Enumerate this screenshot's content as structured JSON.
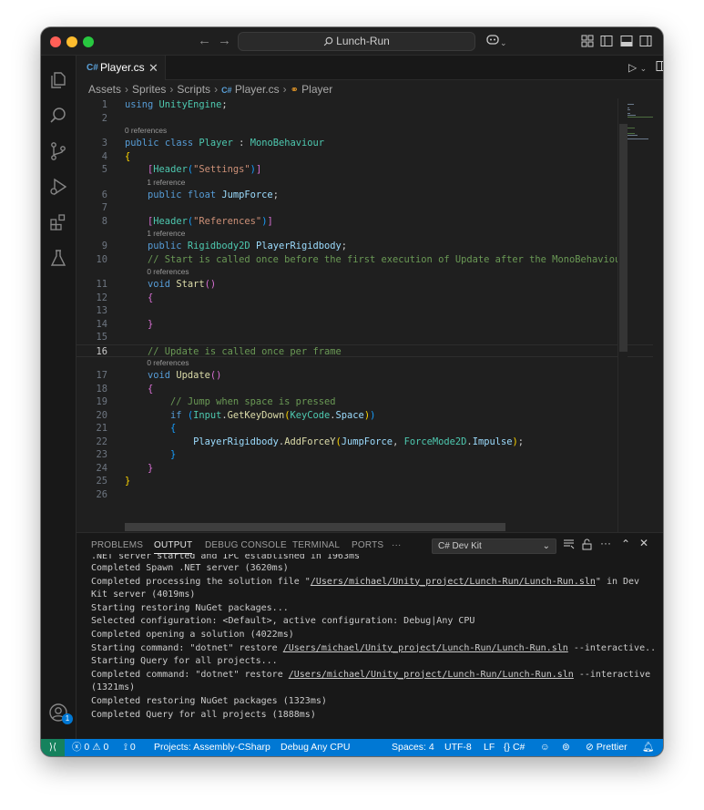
{
  "window": {
    "search_text": "Lunch-Run"
  },
  "tab": {
    "label": "Player.cs",
    "icon": "csharp-file-icon"
  },
  "breadcrumb": {
    "items": [
      "Assets",
      "Sprites",
      "Scripts",
      "Player.cs",
      "Player"
    ]
  },
  "code": {
    "current_line": 16,
    "lines": [
      {
        "n": "1",
        "lens": "",
        "text": "using UnityEngine;"
      },
      {
        "n": "2",
        "lens": "",
        "text": ""
      },
      {
        "n": "3",
        "lens": "0 references",
        "text": "public class Player : MonoBehaviour"
      },
      {
        "n": "4",
        "lens": "",
        "text": "{"
      },
      {
        "n": "5",
        "lens": "",
        "text": "    [Header(\"Settings\")]"
      },
      {
        "n": "6",
        "lens": "1 reference",
        "text": "    public float JumpForce;"
      },
      {
        "n": "7",
        "lens": "",
        "text": ""
      },
      {
        "n": "8",
        "lens": "",
        "text": "    [Header(\"References\")]"
      },
      {
        "n": "9",
        "lens": "1 reference",
        "text": "    public Rigidbody2D PlayerRigidbody;"
      },
      {
        "n": "10",
        "lens": "",
        "text": "    // Start is called once before the first execution of Update after the MonoBehaviou"
      },
      {
        "n": "11",
        "lens": "0 references",
        "text": "    void Start()"
      },
      {
        "n": "12",
        "lens": "",
        "text": "    {"
      },
      {
        "n": "13",
        "lens": "",
        "text": ""
      },
      {
        "n": "14",
        "lens": "",
        "text": "    }"
      },
      {
        "n": "15",
        "lens": "",
        "text": ""
      },
      {
        "n": "16",
        "lens": "",
        "text": "    // Update is called once per frame"
      },
      {
        "n": "17",
        "lens": "0 references",
        "text": "    void Update()"
      },
      {
        "n": "18",
        "lens": "",
        "text": "    {"
      },
      {
        "n": "19",
        "lens": "",
        "text": "        // Jump when space is pressed"
      },
      {
        "n": "20",
        "lens": "",
        "text": "        if (Input.GetKeyDown(KeyCode.Space))"
      },
      {
        "n": "21",
        "lens": "",
        "text": "        {"
      },
      {
        "n": "22",
        "lens": "",
        "text": "            PlayerRigidbody.AddForceY(JumpForce, ForceMode2D.Impulse);"
      },
      {
        "n": "23",
        "lens": "",
        "text": "        }"
      },
      {
        "n": "24",
        "lens": "",
        "text": "    }"
      },
      {
        "n": "25",
        "lens": "",
        "text": "}"
      },
      {
        "n": "26",
        "lens": "",
        "text": ""
      }
    ]
  },
  "panel": {
    "tabs": [
      "PROBLEMS",
      "OUTPUT",
      "DEBUG CONSOLE",
      "TERMINAL",
      "PORTS",
      "···"
    ],
    "active_tab": "OUTPUT",
    "channel": "C# Dev Kit",
    "output_lines": [
      ".NET server started and IPC established in 1963ms",
      "Completed Spawn .NET server (3620ms)",
      "Completed processing the solution file \"/Users/michael/Unity_project/Lunch-Run/Lunch-Run.sln\" in Dev",
      "Kit server (4019ms)",
      "Starting restoring NuGet packages...",
      "Selected configuration: <Default>, active configuration: Debug|Any CPU",
      "Completed opening a solution (4022ms)",
      "Starting command: \"dotnet\" restore /Users/michael/Unity_project/Lunch-Run/Lunch-Run.sln --interactive...",
      "Starting Query for all projects...",
      "Completed command: \"dotnet\" restore /Users/michael/Unity_project/Lunch-Run/Lunch-Run.sln --interactive",
      "(1321ms)",
      "Completed restoring NuGet packages (1323ms)",
      "Completed Query for all projects (1888ms)"
    ]
  },
  "status": {
    "errors": "0",
    "warnings": "0",
    "ports": "0",
    "project": "Projects: Assembly-CSharp",
    "debug": "Debug Any CPU",
    "spaces": "Spaces: 4",
    "encoding": "UTF-8",
    "eol": "LF",
    "language": "C#",
    "formatter": "Prettier"
  },
  "activity": {
    "account_badge": "1"
  },
  "colors": {
    "statusbar": "#0078d4",
    "remote": "#16825d",
    "editor_bg": "#1f1f1f"
  }
}
